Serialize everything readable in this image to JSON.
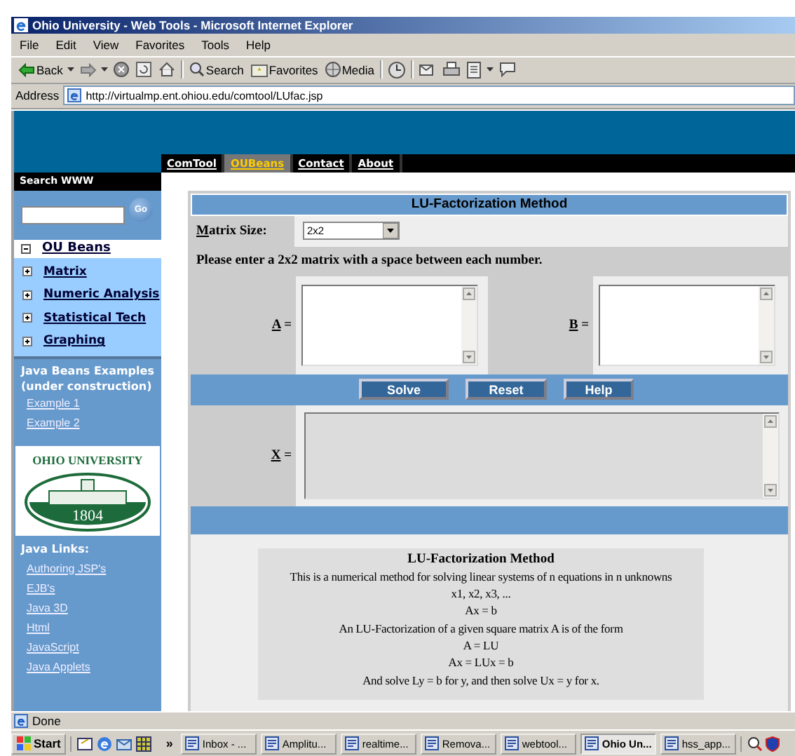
{
  "window": {
    "title": "Ohio University - Web Tools - Microsoft Internet Explorer"
  },
  "menu": [
    "File",
    "Edit",
    "View",
    "Favorites",
    "Tools",
    "Help"
  ],
  "toolbar": [
    {
      "kind": "back",
      "label": "Back"
    },
    {
      "kind": "forward"
    },
    {
      "kind": "stop"
    },
    {
      "kind": "refresh"
    },
    {
      "kind": "home"
    },
    {
      "kind": "search",
      "label": "Search"
    },
    {
      "kind": "favorites",
      "label": "Favorites"
    },
    {
      "kind": "media",
      "label": "Media"
    },
    {
      "kind": "history"
    },
    {
      "kind": "mail"
    },
    {
      "kind": "print"
    },
    {
      "kind": "edit"
    },
    {
      "kind": "discuss"
    }
  ],
  "address": {
    "label": "Address",
    "url": "http://virtualmp.ent.ohiou.edu/comtool/LUfac.jsp"
  },
  "nav_tabs": [
    {
      "label": "ComTool",
      "selected": false
    },
    {
      "label": "OUBeans",
      "selected": true
    },
    {
      "label": "Contact",
      "selected": false
    },
    {
      "label": "About",
      "selected": false
    }
  ],
  "sidebar": {
    "search_title": "Search WWW",
    "go": "Go",
    "tree": {
      "label": "OU Beans",
      "expanded": true,
      "children": [
        {
          "label": "Matrix",
          "expanded": false
        },
        {
          "label": "Numeric Analysis",
          "expanded": false
        },
        {
          "label": "Statistical Tech",
          "expanded": false
        },
        {
          "label": "Graphing",
          "expanded": false
        }
      ]
    },
    "examples": {
      "title": "Java Beans Examples (under construction)",
      "links": [
        "Example 1",
        "Example 2"
      ]
    },
    "logo": {
      "name": "OHIO UNIVERSITY",
      "year": "1804"
    },
    "java_links": {
      "title": "Java Links:",
      "links": [
        "Authoring JSP's",
        "EJB's",
        "Java 3D",
        "Html",
        "JavaScript",
        "Java Applets"
      ]
    }
  },
  "form": {
    "title": "LU-Factorization Method",
    "size_label": "Matrix Size:",
    "size_value": "2x2",
    "instruction": "Please enter a 2x2 matrix with a space between each number.",
    "inputs": [
      {
        "label": "A ="
      },
      {
        "label": "B ="
      }
    ],
    "buttons": [
      "Solve",
      "Reset",
      "Help"
    ],
    "result_label": "X ="
  },
  "description": {
    "title": "LU-Factorization Method",
    "lines": [
      "This is a numerical method for solving linear systems of n equations in n unknowns",
      "x1, x2, x3, ...",
      "Ax = b",
      "An LU-Factorization of a given square matrix A is of the form",
      "A = LU",
      "Ax = LUx = b",
      "And solve Ly = b for y, and then solve Ux = y for x."
    ]
  },
  "status_bar": {
    "text": "Done"
  },
  "taskbar": {
    "start": "Start",
    "chevron": "»",
    "tasks": [
      {
        "label": "Inbox - ...",
        "selected": false
      },
      {
        "label": "Amplitu...",
        "selected": false
      },
      {
        "label": "realtime...",
        "selected": false
      },
      {
        "label": "Remova...",
        "selected": false
      },
      {
        "label": "webtool...",
        "selected": false
      },
      {
        "label": "Ohio Un...",
        "selected": true
      },
      {
        "label": "hss_app...",
        "selected": false
      }
    ]
  }
}
